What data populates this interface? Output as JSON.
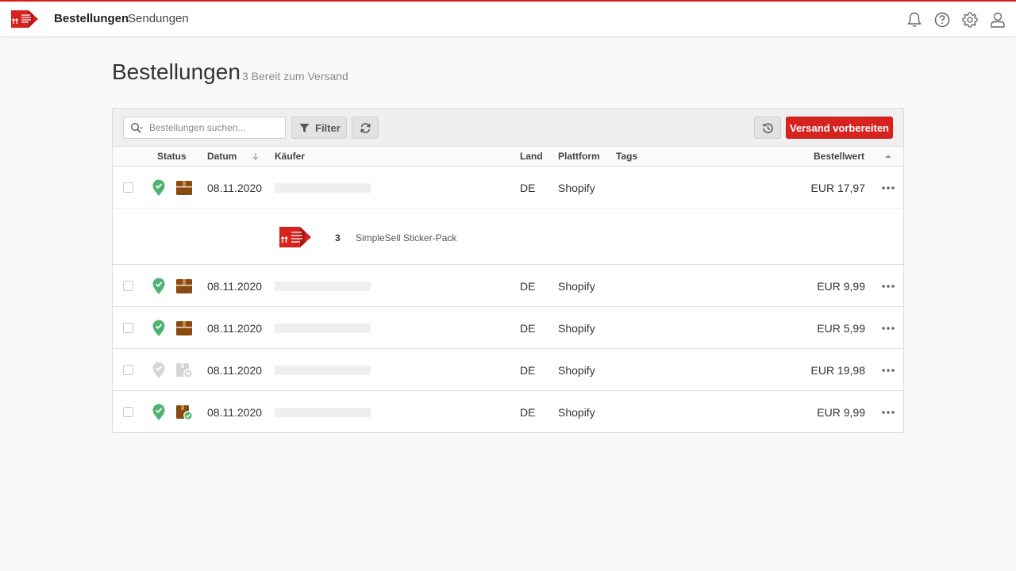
{
  "nav": {
    "items": [
      {
        "label": "Bestellungen",
        "active": true
      },
      {
        "label": "Sendungen",
        "active": false
      }
    ],
    "icons": [
      "bell-icon",
      "help-icon",
      "gear-icon",
      "user-icon"
    ]
  },
  "page": {
    "title": "Bestellungen",
    "subtitle": "3 Bereit zum Versand"
  },
  "toolbar": {
    "search_placeholder": "Bestellungen suchen...",
    "filter_label": "Filter",
    "primary_label": "Versand vorbereiten"
  },
  "table": {
    "headers": {
      "status": "Status",
      "datum": "Datum",
      "kaeufer": "Käufer",
      "land": "Land",
      "plattform": "Plattform",
      "tags": "Tags",
      "bestellwert": "Bestellwert"
    },
    "rows": [
      {
        "date": "08.11.2020",
        "land": "DE",
        "platform": "Shopify",
        "amount": "EUR 17,97",
        "location_status": "verified",
        "box_status": "ready"
      },
      {
        "date": "08.11.2020",
        "land": "DE",
        "platform": "Shopify",
        "amount": "EUR 9,99",
        "location_status": "verified",
        "box_status": "ready"
      },
      {
        "date": "08.11.2020",
        "land": "DE",
        "platform": "Shopify",
        "amount": "EUR 5,99",
        "location_status": "verified",
        "box_status": "ready"
      },
      {
        "date": "08.11.2020",
        "land": "DE",
        "platform": "Shopify",
        "amount": "EUR 19,98",
        "location_status": "inactive",
        "box_status": "cancelled"
      },
      {
        "date": "08.11.2020",
        "land": "DE",
        "platform": "Shopify",
        "amount": "EUR 9,99",
        "location_status": "verified",
        "box_status": "shipped"
      }
    ],
    "detail": {
      "qty": "3",
      "product": "SimpleSell Sticker-Pack"
    }
  },
  "colors": {
    "brand": "#d7231f",
    "success": "#4fb473",
    "box": "#8b4a12",
    "inactive": "#cfcfcf"
  }
}
